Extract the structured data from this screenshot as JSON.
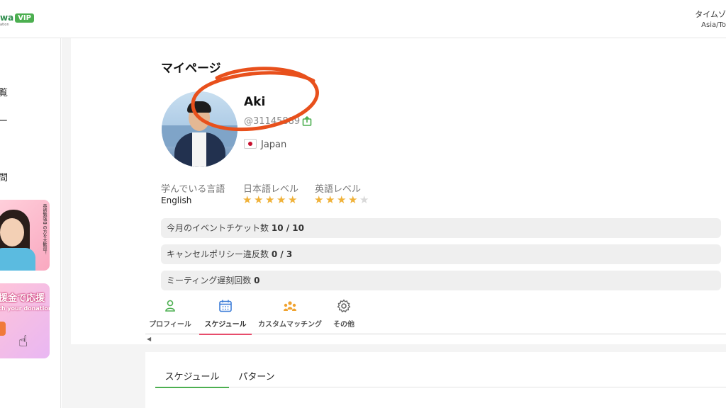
{
  "header": {
    "logo_word": "wa",
    "logo_badge": "VIP",
    "logo_sub": "ation",
    "timezone_label": "タイムゾ",
    "timezone_value": "Asia/To"
  },
  "sidebar": {
    "items": [
      {
        "label": "覧"
      },
      {
        "label": "ー"
      },
      {
        "label": "問"
      }
    ],
    "banner1_text": "英語勉強中の方を大歓迎！",
    "banner2_title": "援金で応援",
    "banner2_sub": "th your donation"
  },
  "profile": {
    "page_title": "マイページ",
    "name": "Aki",
    "user_id": "@31145889",
    "country": "Japan",
    "learning_label": "学んでいる言語",
    "learning_value": "English",
    "japanese_level_label": "日本語レベル",
    "japanese_level": 5,
    "english_level_label": "英語レベル",
    "english_level": 4,
    "max_level": 5
  },
  "stats": {
    "tickets_label": "今月のイベントチケット数",
    "tickets_value": "10 / 10",
    "cancel_label": "キャンセルポリシー違反数",
    "cancel_value": "0 / 3",
    "late_label": "ミーティング遅刻回数",
    "late_value": "0"
  },
  "tabs": [
    {
      "label": "プロフィール",
      "icon": "person-icon",
      "color": "#4caf50"
    },
    {
      "label": "スケジュール",
      "icon": "calendar-icon",
      "color": "#3f7fd8",
      "active": true
    },
    {
      "label": "カスタムマッチング",
      "icon": "group-icon",
      "color": "#f0a330"
    },
    {
      "label": "その他",
      "icon": "gear-icon",
      "color": "#666666"
    }
  ],
  "subtabs": [
    {
      "label": "スケジュール",
      "active": true
    },
    {
      "label": "パターン"
    }
  ],
  "colors": {
    "accent_red": "#e74c6b",
    "accent_green": "#4caf50",
    "star": "#f0b23a",
    "annotation": "#e8501c"
  }
}
